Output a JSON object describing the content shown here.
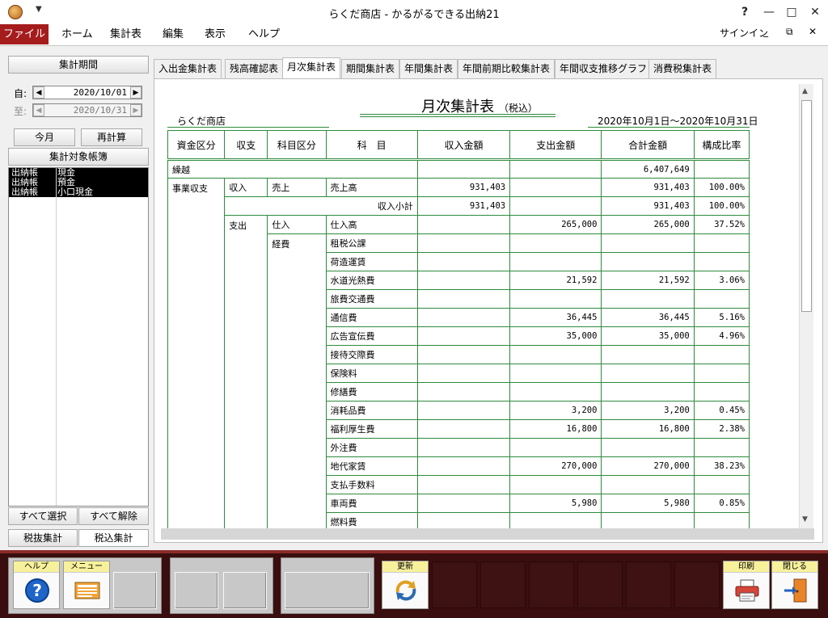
{
  "window": {
    "title": "らくだ商店 - かるがるできる出納21",
    "qa_caret": "▼"
  },
  "window_controls": {
    "help": "?",
    "minimize": "—",
    "maximize": "□",
    "close": "✕"
  },
  "ribbon": {
    "tabs": [
      "ファイル",
      "ホーム",
      "集計表",
      "編集",
      "表示",
      "ヘルプ"
    ],
    "signin": "サインイン"
  },
  "sidebar": {
    "period_header": "集計期間",
    "from_label": "自:",
    "to_label": "至:",
    "from_date": "2020/10/01",
    "to_date": "2020/10/31",
    "this_month": "今月",
    "recalc": "再計算",
    "target_books": "集計対象帳簿",
    "accounts": [
      {
        "book": "出納帳",
        "name": "現金"
      },
      {
        "book": "出納帳",
        "name": "預金"
      },
      {
        "book": "出納帳",
        "name": "小口現金"
      }
    ],
    "select_all": "すべて選択",
    "deselect_all": "すべて解除",
    "tax_excluded": "税抜集計",
    "tax_included": "税込集計"
  },
  "tabs": [
    "入出金集計表",
    "残高確認表",
    "月次集計表",
    "期間集計表",
    "年間集計表",
    "年間前期比較集計表",
    "年間収支推移グラフ",
    "消費税集計表"
  ],
  "active_tab": "月次集計表",
  "report": {
    "title": "月次集計表",
    "title_suffix": "（税込）",
    "company": "らくだ商店",
    "period": "2020年10月1日～2020年10月31日",
    "headers": [
      "資金区分",
      "収支",
      "科目区分",
      "科　目",
      "収入金額",
      "支出金額",
      "合計金額",
      "構成比率"
    ],
    "carryover": {
      "label": "繰越",
      "total": "6,407,649"
    },
    "rows": [
      {
        "fund": "事業収支",
        "io": "収入",
        "cat": "売上",
        "item": "売上高",
        "income": "931,403",
        "expense": "",
        "total": "931,403",
        "ratio": "100.00%"
      },
      {
        "fund": "",
        "io": "",
        "cat": "",
        "item": "収入小計",
        "income": "931,403",
        "expense": "",
        "total": "931,403",
        "ratio": "100.00%",
        "subtotal": true
      },
      {
        "fund": "",
        "io": "支出",
        "cat": "仕入",
        "item": "仕入高",
        "income": "",
        "expense": "265,000",
        "total": "265,000",
        "ratio": "37.52%"
      },
      {
        "fund": "",
        "io": "",
        "cat": "経費",
        "item": "租税公課",
        "income": "",
        "expense": "",
        "total": "",
        "ratio": ""
      },
      {
        "fund": "",
        "io": "",
        "cat": "",
        "item": "荷造運賃",
        "income": "",
        "expense": "",
        "total": "",
        "ratio": ""
      },
      {
        "fund": "",
        "io": "",
        "cat": "",
        "item": "水道光熱費",
        "income": "",
        "expense": "21,592",
        "total": "21,592",
        "ratio": "3.06%"
      },
      {
        "fund": "",
        "io": "",
        "cat": "",
        "item": "旅費交通費",
        "income": "",
        "expense": "",
        "total": "",
        "ratio": ""
      },
      {
        "fund": "",
        "io": "",
        "cat": "",
        "item": "通信費",
        "income": "",
        "expense": "36,445",
        "total": "36,445",
        "ratio": "5.16%"
      },
      {
        "fund": "",
        "io": "",
        "cat": "",
        "item": "広告宣伝費",
        "income": "",
        "expense": "35,000",
        "total": "35,000",
        "ratio": "4.96%"
      },
      {
        "fund": "",
        "io": "",
        "cat": "",
        "item": "接待交際費",
        "income": "",
        "expense": "",
        "total": "",
        "ratio": ""
      },
      {
        "fund": "",
        "io": "",
        "cat": "",
        "item": "保険料",
        "income": "",
        "expense": "",
        "total": "",
        "ratio": ""
      },
      {
        "fund": "",
        "io": "",
        "cat": "",
        "item": "修繕費",
        "income": "",
        "expense": "",
        "total": "",
        "ratio": ""
      },
      {
        "fund": "",
        "io": "",
        "cat": "",
        "item": "消耗品費",
        "income": "",
        "expense": "3,200",
        "total": "3,200",
        "ratio": "0.45%"
      },
      {
        "fund": "",
        "io": "",
        "cat": "",
        "item": "福利厚生費",
        "income": "",
        "expense": "16,800",
        "total": "16,800",
        "ratio": "2.38%"
      },
      {
        "fund": "",
        "io": "",
        "cat": "",
        "item": "外注費",
        "income": "",
        "expense": "",
        "total": "",
        "ratio": ""
      },
      {
        "fund": "",
        "io": "",
        "cat": "",
        "item": "地代家賃",
        "income": "",
        "expense": "270,000",
        "total": "270,000",
        "ratio": "38.23%"
      },
      {
        "fund": "",
        "io": "",
        "cat": "",
        "item": "支払手数料",
        "income": "",
        "expense": "",
        "total": "",
        "ratio": ""
      },
      {
        "fund": "",
        "io": "",
        "cat": "",
        "item": "車両費",
        "income": "",
        "expense": "5,980",
        "total": "5,980",
        "ratio": "0.85%"
      },
      {
        "fund": "",
        "io": "",
        "cat": "",
        "item": "燃料費",
        "income": "",
        "expense": "",
        "total": "",
        "ratio": ""
      }
    ]
  },
  "bottom": {
    "help": "ヘルプ",
    "menu": "メニュー",
    "refresh": "更新",
    "print": "印刷",
    "close": "閉じる"
  },
  "colors": {
    "file_tab": "#a51c1c",
    "grid_line": "#2e8b3c",
    "bottom_bar": "#3a0e0e",
    "caption_yellow": "#f7f19b"
  }
}
